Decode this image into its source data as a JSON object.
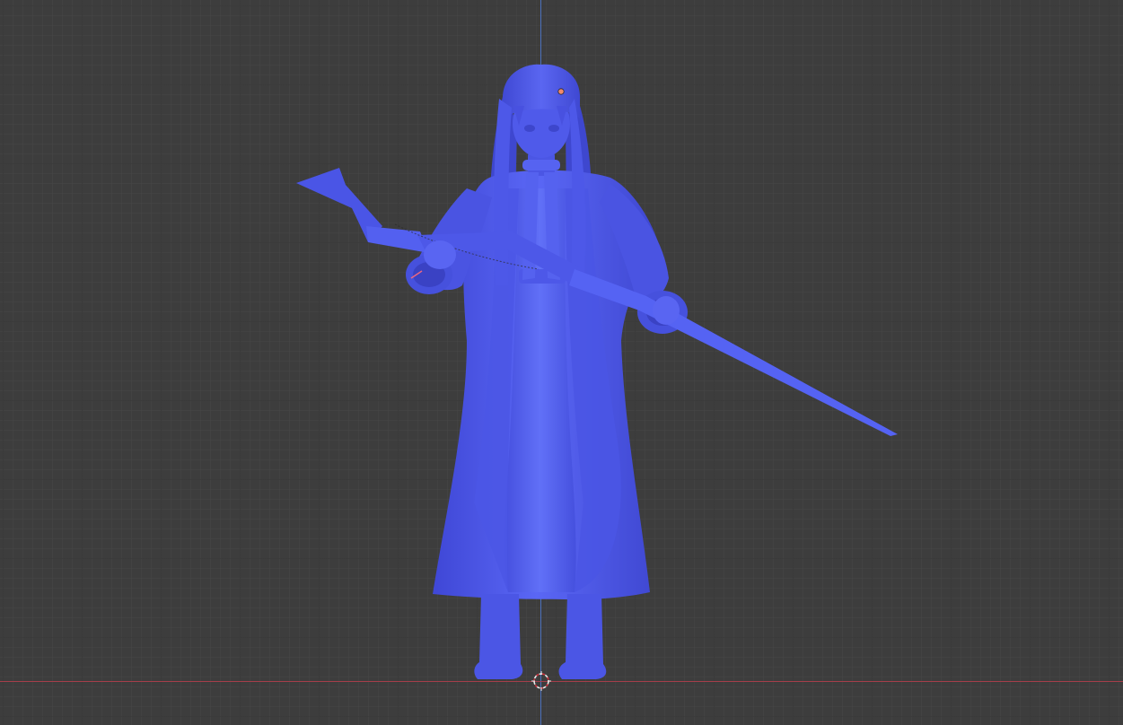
{
  "app": "3D viewport",
  "view": {
    "shading": "solid",
    "model_color": "#4f5cf0",
    "background_color": "#3d3d3d",
    "grid": true,
    "axes": {
      "x_axis_color": "#b03e4b",
      "z_axis_color": "#4f7ad3"
    }
  },
  "scene": {
    "object": "character-figure-with-rifle",
    "has_origin_marker": true,
    "has_3d_cursor": true
  }
}
